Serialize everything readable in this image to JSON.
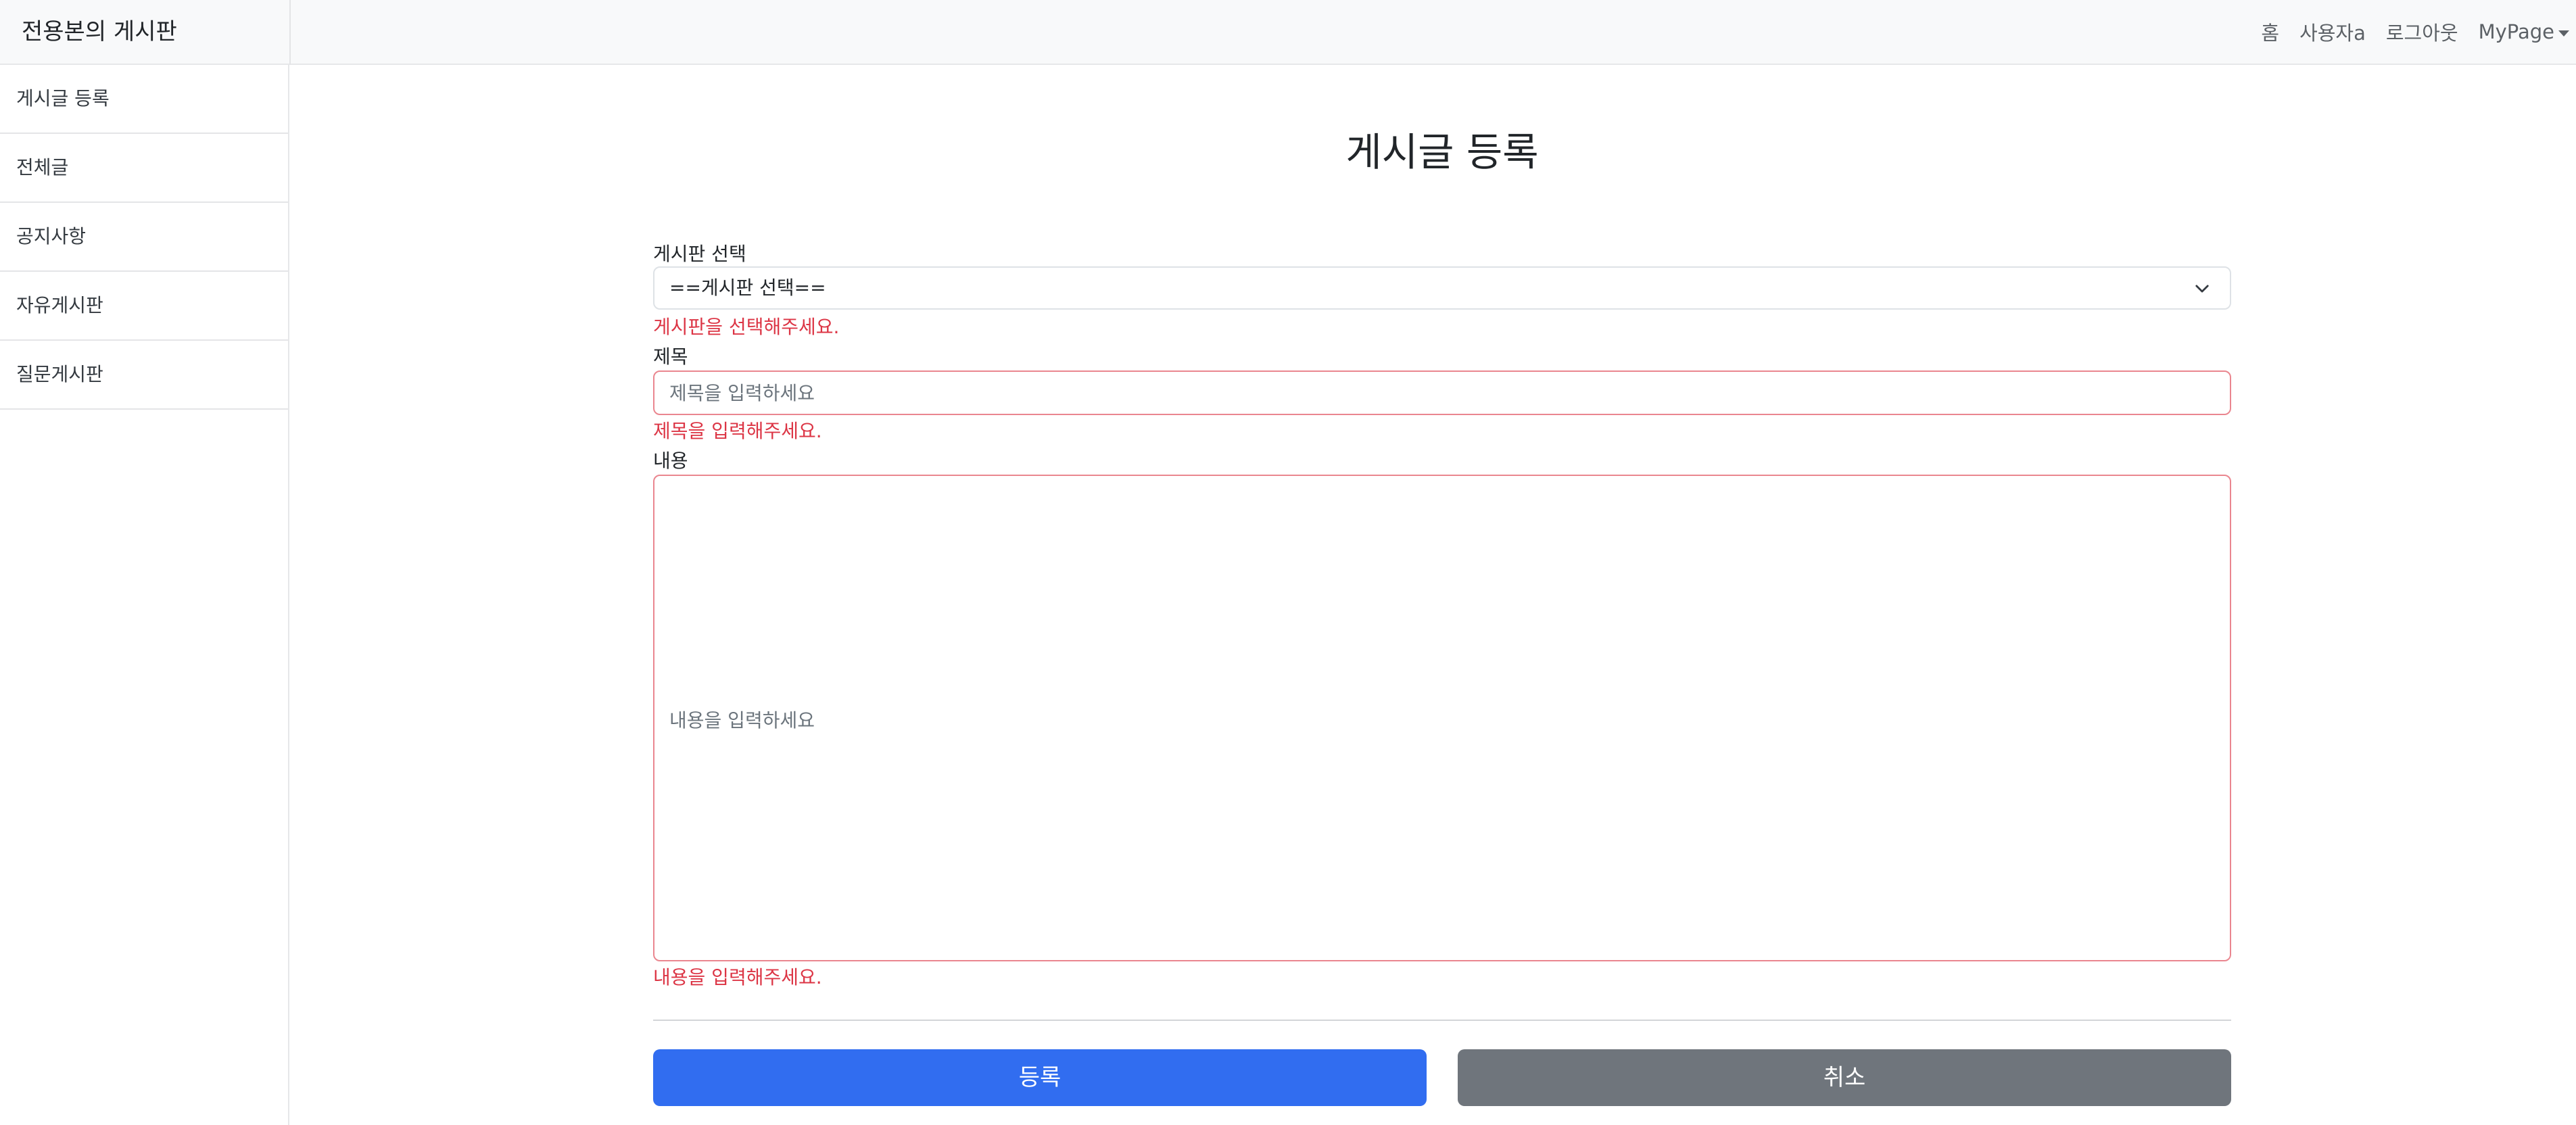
{
  "navbar": {
    "brand": "전용본의 게시판",
    "links": {
      "home": "홈",
      "user": "사용자a",
      "logout": "로그아웃",
      "mypage": "MyPage"
    }
  },
  "sidebar": {
    "items": [
      {
        "label": "게시글 등록"
      },
      {
        "label": "전체글"
      },
      {
        "label": "공지사항"
      },
      {
        "label": "자유게시판"
      },
      {
        "label": "질문게시판"
      }
    ]
  },
  "form": {
    "title": "게시글 등록",
    "board": {
      "label": "게시판 선택",
      "selected": "==게시판 선택==",
      "error": "게시판을 선택해주세요."
    },
    "subject": {
      "label": "제목",
      "placeholder": "제목을 입력하세요",
      "value": "",
      "error": "제목을 입력해주세요."
    },
    "content": {
      "label": "내용",
      "placeholder": "내용을 입력하세요",
      "error": "내용을 입력해주세요."
    },
    "submit_label": "등록",
    "cancel_label": "취소"
  },
  "colors": {
    "primary": "#316df0",
    "secondary": "#6f757c",
    "error": "#dc3545",
    "invalid_border": "#ea868f"
  }
}
